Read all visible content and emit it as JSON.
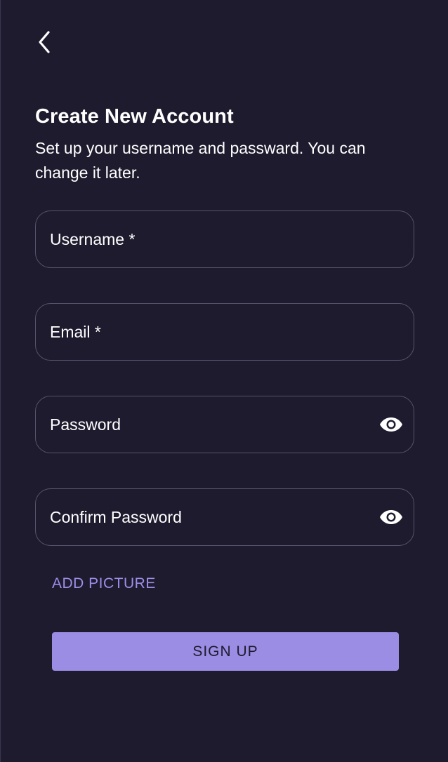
{
  "header": {
    "back_icon": "chevron-left-icon",
    "title": "Create New Account",
    "subtitle": "Set up your username and passward. You can change it later."
  },
  "form": {
    "username_label": "Username *",
    "email_label": "Email *",
    "password_label": "Password",
    "confirm_password_label": "Confirm Password",
    "visibility_icon": "eye-icon"
  },
  "actions": {
    "add_picture": "ADD PICTURE",
    "sign_up": "SIGN UP"
  },
  "colors": {
    "background": "#1e1b2e",
    "accent": "#9a8de3",
    "link": "#9c8fe8",
    "field_border": "#57536b"
  }
}
